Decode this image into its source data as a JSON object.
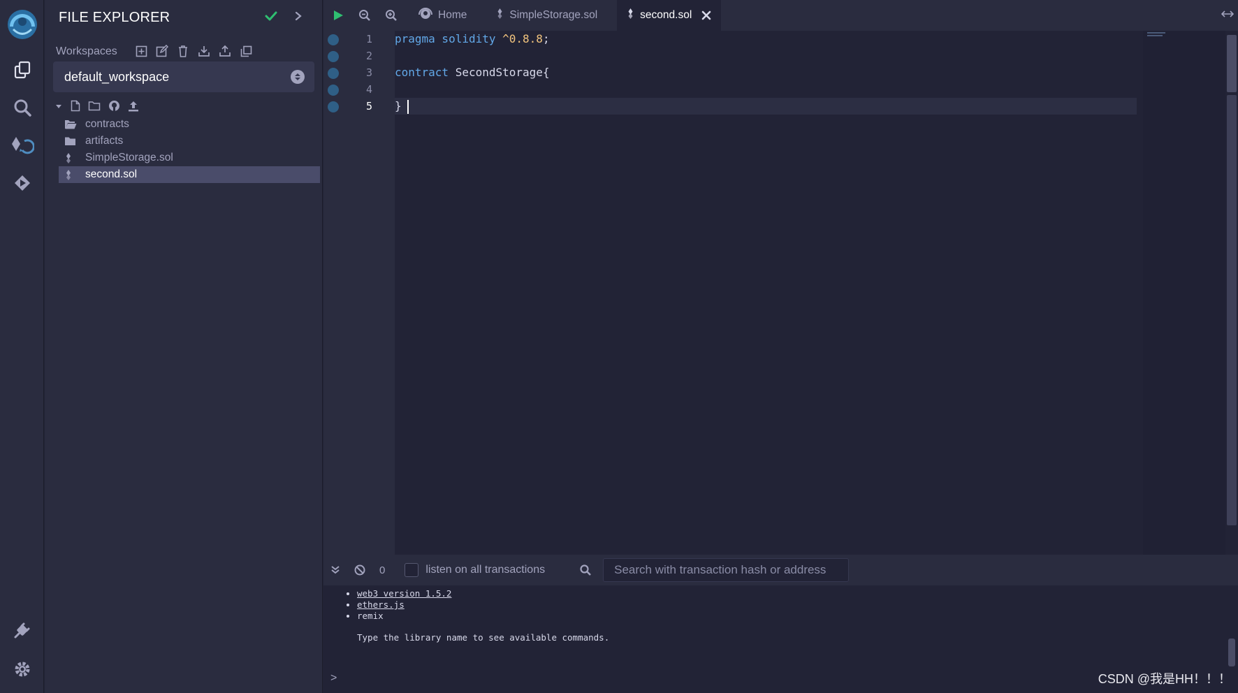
{
  "panel": {
    "title": "FILE EXPLORER",
    "workspaces_label": "Workspaces",
    "workspace_selected": "default_workspace",
    "workspace_actions": [
      "create-workspace-icon",
      "rename-workspace-icon",
      "delete-workspace-icon",
      "download-workspace-icon",
      "restore-workspace-icon",
      "clone-workspace-icon"
    ],
    "tree_actions": [
      "new-file-icon",
      "new-folder-icon",
      "github-icon",
      "upload-icon"
    ],
    "files": [
      {
        "name": "contracts",
        "type": "folder-open"
      },
      {
        "name": "artifacts",
        "type": "folder"
      },
      {
        "name": "SimpleStorage.sol",
        "type": "solidity"
      },
      {
        "name": "second.sol",
        "type": "solidity",
        "active": true
      }
    ]
  },
  "tabs": {
    "items": [
      {
        "label": "Home",
        "icon": "remix-home-icon"
      },
      {
        "label": "SimpleStorage.sol",
        "icon": "solidity-icon"
      },
      {
        "label": "second.sol",
        "icon": "solidity-icon",
        "active": true
      }
    ]
  },
  "editor": {
    "line_numbers": [
      "1",
      "2",
      "3",
      "4",
      "5"
    ],
    "current_line": 5,
    "lines": [
      {
        "kw": "pragma solidity",
        "num": "^0.8.8",
        "rest": ";"
      },
      {
        "kw": "",
        "num": "",
        "rest": ""
      },
      {
        "kw": "contract",
        "num": "",
        "rest": " SecondStorage{"
      },
      {
        "kw": "",
        "num": "",
        "rest": ""
      },
      {
        "kw": "",
        "num": "",
        "rest": "}"
      }
    ]
  },
  "terminal": {
    "count": "0",
    "listen_label": "listen on all transactions",
    "search_placeholder": "Search with transaction hash or address",
    "libs": [
      "web3 version 1.5.2",
      "ethers.js",
      "remix"
    ],
    "hint": "Type the library name to see available commands.",
    "prompt": ">"
  },
  "watermark": "CSDN @我是HH！！！",
  "colors": {
    "accent_green": "#2fbf71",
    "run_green": "#2fbf71",
    "breakpoint": "#2f5f86",
    "keyword": "#62a8e8",
    "number": "#f2c47e"
  }
}
